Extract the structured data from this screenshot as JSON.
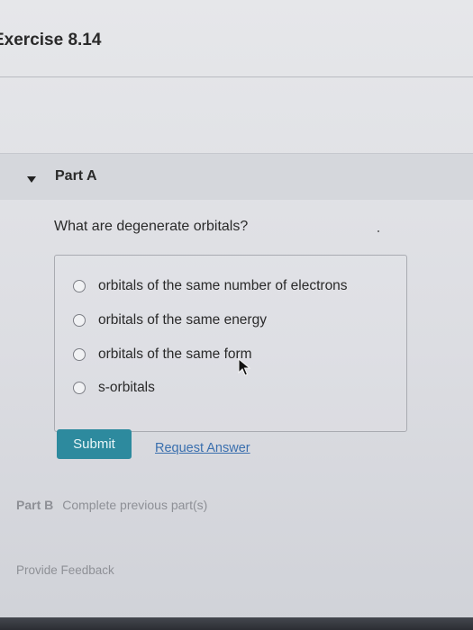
{
  "header": {
    "title": "Exercise 8.14"
  },
  "part_a": {
    "label": "Part A",
    "question": "What are degenerate orbitals?",
    "options": [
      {
        "label": "orbitals of the same number of electrons"
      },
      {
        "label": "orbitals of the same energy"
      },
      {
        "label": "orbitals of the same form"
      },
      {
        "label": "s-orbitals"
      }
    ],
    "submit_label": "Submit",
    "request_answer_label": "Request Answer"
  },
  "part_b": {
    "label": "Part B",
    "status": "Complete previous part(s)"
  },
  "footer": {
    "feedback_label": "Provide Feedback"
  },
  "colors": {
    "submit_bg": "#2d8a9e",
    "link": "#3a6fae"
  }
}
